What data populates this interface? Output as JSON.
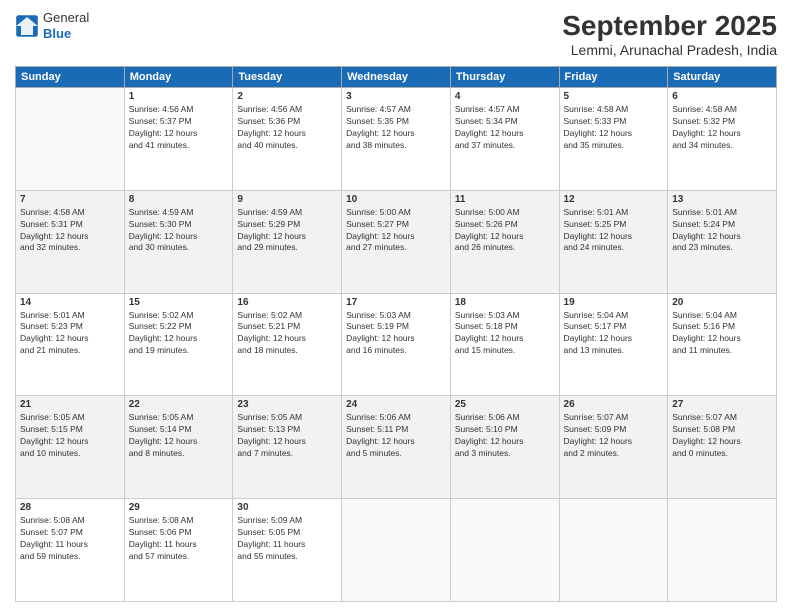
{
  "header": {
    "logo_general": "General",
    "logo_blue": "Blue",
    "title": "September 2025",
    "location": "Lemmi, Arunachal Pradesh, India"
  },
  "columns": [
    "Sunday",
    "Monday",
    "Tuesday",
    "Wednesday",
    "Thursday",
    "Friday",
    "Saturday"
  ],
  "weeks": [
    [
      {
        "day": "",
        "content": ""
      },
      {
        "day": "1",
        "content": "Sunrise: 4:56 AM\nSunset: 5:37 PM\nDaylight: 12 hours\nand 41 minutes."
      },
      {
        "day": "2",
        "content": "Sunrise: 4:56 AM\nSunset: 5:36 PM\nDaylight: 12 hours\nand 40 minutes."
      },
      {
        "day": "3",
        "content": "Sunrise: 4:57 AM\nSunset: 5:35 PM\nDaylight: 12 hours\nand 38 minutes."
      },
      {
        "day": "4",
        "content": "Sunrise: 4:57 AM\nSunset: 5:34 PM\nDaylight: 12 hours\nand 37 minutes."
      },
      {
        "day": "5",
        "content": "Sunrise: 4:58 AM\nSunset: 5:33 PM\nDaylight: 12 hours\nand 35 minutes."
      },
      {
        "day": "6",
        "content": "Sunrise: 4:58 AM\nSunset: 5:32 PM\nDaylight: 12 hours\nand 34 minutes."
      }
    ],
    [
      {
        "day": "7",
        "content": "Sunrise: 4:58 AM\nSunset: 5:31 PM\nDaylight: 12 hours\nand 32 minutes."
      },
      {
        "day": "8",
        "content": "Sunrise: 4:59 AM\nSunset: 5:30 PM\nDaylight: 12 hours\nand 30 minutes."
      },
      {
        "day": "9",
        "content": "Sunrise: 4:59 AM\nSunset: 5:29 PM\nDaylight: 12 hours\nand 29 minutes."
      },
      {
        "day": "10",
        "content": "Sunrise: 5:00 AM\nSunset: 5:27 PM\nDaylight: 12 hours\nand 27 minutes."
      },
      {
        "day": "11",
        "content": "Sunrise: 5:00 AM\nSunset: 5:26 PM\nDaylight: 12 hours\nand 26 minutes."
      },
      {
        "day": "12",
        "content": "Sunrise: 5:01 AM\nSunset: 5:25 PM\nDaylight: 12 hours\nand 24 minutes."
      },
      {
        "day": "13",
        "content": "Sunrise: 5:01 AM\nSunset: 5:24 PM\nDaylight: 12 hours\nand 23 minutes."
      }
    ],
    [
      {
        "day": "14",
        "content": "Sunrise: 5:01 AM\nSunset: 5:23 PM\nDaylight: 12 hours\nand 21 minutes."
      },
      {
        "day": "15",
        "content": "Sunrise: 5:02 AM\nSunset: 5:22 PM\nDaylight: 12 hours\nand 19 minutes."
      },
      {
        "day": "16",
        "content": "Sunrise: 5:02 AM\nSunset: 5:21 PM\nDaylight: 12 hours\nand 18 minutes."
      },
      {
        "day": "17",
        "content": "Sunrise: 5:03 AM\nSunset: 5:19 PM\nDaylight: 12 hours\nand 16 minutes."
      },
      {
        "day": "18",
        "content": "Sunrise: 5:03 AM\nSunset: 5:18 PM\nDaylight: 12 hours\nand 15 minutes."
      },
      {
        "day": "19",
        "content": "Sunrise: 5:04 AM\nSunset: 5:17 PM\nDaylight: 12 hours\nand 13 minutes."
      },
      {
        "day": "20",
        "content": "Sunrise: 5:04 AM\nSunset: 5:16 PM\nDaylight: 12 hours\nand 11 minutes."
      }
    ],
    [
      {
        "day": "21",
        "content": "Sunrise: 5:05 AM\nSunset: 5:15 PM\nDaylight: 12 hours\nand 10 minutes."
      },
      {
        "day": "22",
        "content": "Sunrise: 5:05 AM\nSunset: 5:14 PM\nDaylight: 12 hours\nand 8 minutes."
      },
      {
        "day": "23",
        "content": "Sunrise: 5:05 AM\nSunset: 5:13 PM\nDaylight: 12 hours\nand 7 minutes."
      },
      {
        "day": "24",
        "content": "Sunrise: 5:06 AM\nSunset: 5:11 PM\nDaylight: 12 hours\nand 5 minutes."
      },
      {
        "day": "25",
        "content": "Sunrise: 5:06 AM\nSunset: 5:10 PM\nDaylight: 12 hours\nand 3 minutes."
      },
      {
        "day": "26",
        "content": "Sunrise: 5:07 AM\nSunset: 5:09 PM\nDaylight: 12 hours\nand 2 minutes."
      },
      {
        "day": "27",
        "content": "Sunrise: 5:07 AM\nSunset: 5:08 PM\nDaylight: 12 hours\nand 0 minutes."
      }
    ],
    [
      {
        "day": "28",
        "content": "Sunrise: 5:08 AM\nSunset: 5:07 PM\nDaylight: 11 hours\nand 59 minutes."
      },
      {
        "day": "29",
        "content": "Sunrise: 5:08 AM\nSunset: 5:06 PM\nDaylight: 11 hours\nand 57 minutes."
      },
      {
        "day": "30",
        "content": "Sunrise: 5:09 AM\nSunset: 5:05 PM\nDaylight: 11 hours\nand 55 minutes."
      },
      {
        "day": "",
        "content": ""
      },
      {
        "day": "",
        "content": ""
      },
      {
        "day": "",
        "content": ""
      },
      {
        "day": "",
        "content": ""
      }
    ]
  ]
}
